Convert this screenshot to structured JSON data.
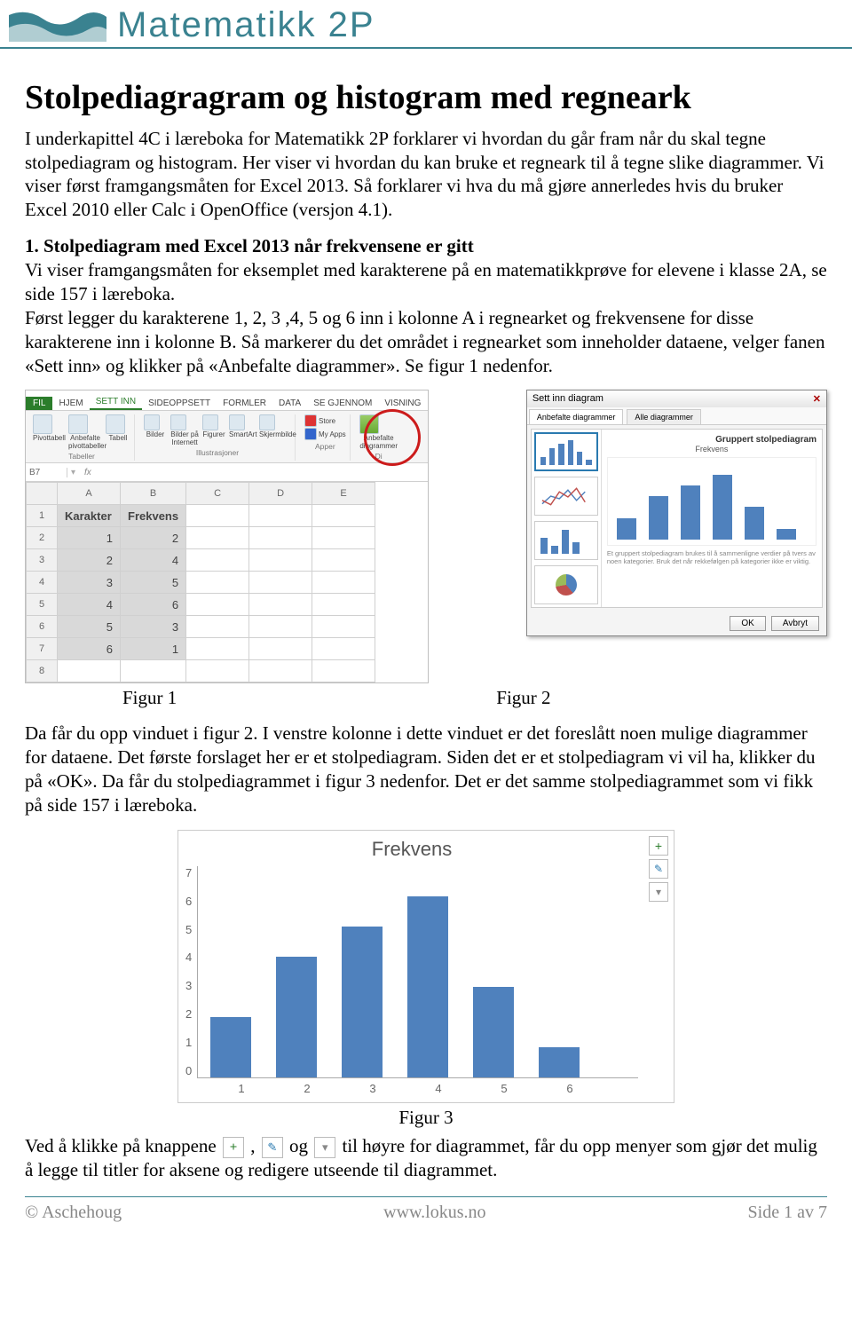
{
  "header": {
    "brand": "Matematikk 2P"
  },
  "title": "Stolpediagragram og histogram med regneark",
  "intro_p1": "I underkapittel 4C i læreboka for Matematikk 2P forklarer vi hvordan du går fram når du skal tegne stolpediagram og histogram. Her viser vi hvordan du kan bruke et regneark til å tegne slike diagrammer. Vi viser først framgangsmåten for Excel 2013. Så forklarer vi hva du må gjøre annerledes hvis du bruker Excel 2010 eller Calc i OpenOffice (versjon 4.1).",
  "section1_head": "1. Stolpediagram med Excel 2013 når frekvensene er gitt",
  "section1_p1": "Vi viser framgangsmåten for eksemplet med karakterene på en matematikkprøve for elevene i klasse 2A, se side 157 i læreboka.",
  "section1_p2": "Først legger du karakterene 1, 2, 3 ,4, 5 og 6 inn i kolonne A i regnearket og frekvensene for disse karakterene inn i kolonne B. Så markerer du det området i regnearket som inneholder dataene, velger fanen «Sett inn» og klikker på «Anbefalte diagrammer». Se figur 1 nedenfor.",
  "excel": {
    "file_tab": "FIL",
    "tabs": [
      "HJEM",
      "SETT INN",
      "SIDEOPPSETT",
      "FORMLER",
      "DATA",
      "SE GJENNOM",
      "VISNING"
    ],
    "active_tab": "SETT INN",
    "groups": {
      "tabeller": "Tabeller",
      "illustrasjoner": "Illustrasjoner",
      "apper": "Apper",
      "di": "Di"
    },
    "group_items": {
      "t1": "Pivottabell",
      "t2": "Anbefalte\npivottabeller",
      "t3": "Tabell",
      "i1": "Bilder",
      "i2": "Bilder på\nInternett",
      "i3": "Figurer",
      "i4": "SmartArt",
      "i5": "Skjermbilde",
      "a1": "Store",
      "a2": "My Apps",
      "d1": "Anbefalte\ndiagrammer"
    },
    "namebox": "B7",
    "headers": {
      "karakter": "Karakter",
      "frekvens": "Frekvens"
    },
    "cols": [
      "A",
      "B",
      "C",
      "D",
      "E"
    ],
    "rows": [
      {
        "n": "1",
        "a": "Karakter",
        "b": "Frekvens"
      },
      {
        "n": "2",
        "a": "1",
        "b": "2"
      },
      {
        "n": "3",
        "a": "2",
        "b": "4"
      },
      {
        "n": "4",
        "a": "3",
        "b": "5"
      },
      {
        "n": "5",
        "a": "4",
        "b": "6"
      },
      {
        "n": "6",
        "a": "5",
        "b": "3"
      },
      {
        "n": "7",
        "a": "6",
        "b": "1"
      },
      {
        "n": "8",
        "a": "",
        "b": ""
      }
    ]
  },
  "dialog": {
    "title": "Sett inn diagram",
    "tab1": "Anbefalte diagrammer",
    "tab2": "Alle diagrammer",
    "preview_title": "Gruppert stolpediagram",
    "preview_series": "Frekvens",
    "subtext": "Et gruppert stolpediagram brukes til å sammenligne verdier på tvers av noen kategorier. Bruk det når rekkefølgen på kategorier ikke er viktig.",
    "ok": "OK",
    "cancel": "Avbryt"
  },
  "fig_labels": {
    "f1": "Figur 1",
    "f2": "Figur 2",
    "f3": "Figur 3"
  },
  "para_after_figs": "Da får du opp vinduet i figur 2. I venstre kolonne i dette vinduet er det foreslått noen mulige diagrammer for dataene. Det første forslaget her er et stolpediagram. Siden det er et stolpediagram vi vil ha, klikker du på «OK». Da får du stolpediagrammet i figur 3 nedenfor. Det er det samme stolpediagrammet som vi fikk på side 157 i læreboka.",
  "chart_data": {
    "type": "bar",
    "title": "Frekvens",
    "categories": [
      "1",
      "2",
      "3",
      "4",
      "5",
      "6"
    ],
    "values": [
      2,
      4,
      5,
      6,
      3,
      1
    ],
    "yticks": [
      "0",
      "1",
      "2",
      "3",
      "4",
      "5",
      "6",
      "7"
    ],
    "ylim": [
      0,
      7
    ],
    "ylabel": "",
    "xlabel": ""
  },
  "final_line_pre": "Ved å klikke på knappene ",
  "final_line_mid1": " , ",
  "final_line_mid2": " og ",
  "final_line_post": " til høyre for diagrammet, får du opp menyer som gjør det mulig å legge til titler for aksene og redigere utseende til diagrammet.",
  "footer": {
    "left": "© Aschehoug",
    "center": "www.lokus.no",
    "right": "Side 1 av 7"
  }
}
